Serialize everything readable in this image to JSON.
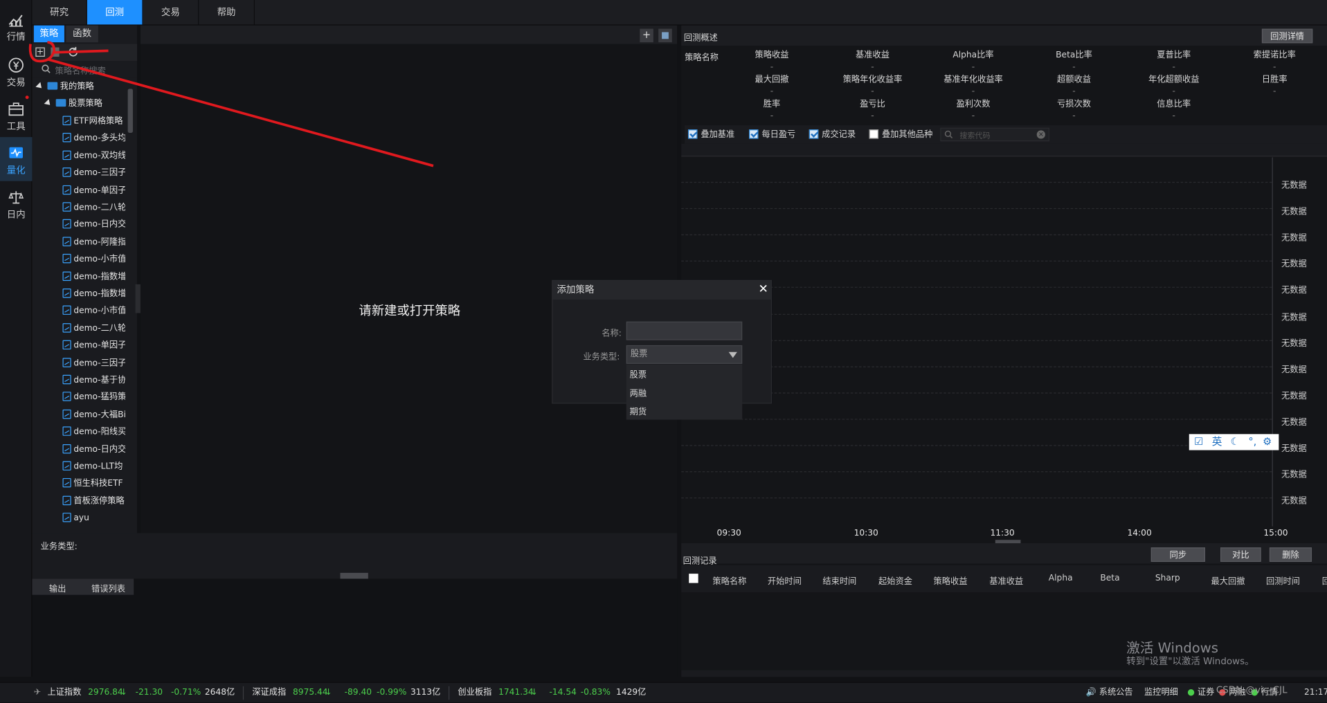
{
  "left_nav": [
    {
      "label": "行情",
      "icon": "chart-trend-icon"
    },
    {
      "label": "交易",
      "icon": "yen-circle-icon"
    },
    {
      "label": "工具",
      "icon": "briefcase-icon"
    },
    {
      "label": "量化",
      "icon": "quant-icon",
      "active": true
    },
    {
      "label": "日内",
      "icon": "scale-icon"
    }
  ],
  "top_tabs": [
    {
      "label": "研究"
    },
    {
      "label": "回测",
      "active": true
    },
    {
      "label": "交易"
    },
    {
      "label": "帮助"
    }
  ],
  "left_panel": {
    "tabs": [
      "策略",
      "函数"
    ],
    "search_placeholder": "策略名称搜索",
    "my_strategies": "我的策略",
    "stock_strategies": "股票策略",
    "items": [
      "ETF网格策略",
      "demo-多头均",
      "demo-双均线",
      "demo-三因子",
      "demo-单因子",
      "demo-二八轮",
      "demo-日内交",
      "demo-阿隆指",
      "demo-小市值",
      "demo-指数增",
      "demo-指数增",
      "demo-小市值",
      "demo-二八轮",
      "demo-单因子",
      "demo-三因子",
      "demo-基于协",
      "demo-猛犸策",
      "demo-大福Bi",
      "demo-阳线买",
      "demo-日内交",
      "demo-LLT均",
      "恒生科技ETF",
      "首板涨停策略",
      "ayu"
    ],
    "business_type_label": "业务类型:"
  },
  "center": {
    "placeholder": "请新建或打开策略",
    "plus_label": "+"
  },
  "output_tabs": [
    "输出",
    "错误列表"
  ],
  "overview": {
    "title": "回测概述",
    "detail_btn": "回测详情",
    "strategy_name_label": "策略名称",
    "row1": [
      "策略收益",
      "基准收益",
      "Alpha比率",
      "Beta比率",
      "夏普比率",
      "索提诺比率"
    ],
    "row2": [
      "最大回撤",
      "策略年化收益率",
      "基准年化收益率",
      "超额收益",
      "年化超额收益",
      "日胜率"
    ],
    "row3": [
      "胜率",
      "盈亏比",
      "盈利次数",
      "亏损次数",
      "信息比率"
    ],
    "empty_value": "-",
    "checkboxes": [
      {
        "label": "叠加基准",
        "checked": true
      },
      {
        "label": "每日盈亏",
        "checked": true
      },
      {
        "label": "成交记录",
        "checked": true
      },
      {
        "label": "叠加其他品种",
        "checked": false
      }
    ],
    "search_placeholder": "搜索代码"
  },
  "chart": {
    "no_data": "无数据",
    "no_data_rows": 13,
    "x_labels": [
      "09:30",
      "10:30",
      "11:30",
      "14:00",
      "15:00"
    ]
  },
  "records": {
    "title": "回测记录",
    "buttons": [
      "同步",
      "对比",
      "删除"
    ],
    "columns": [
      "策略名称",
      "开始时间",
      "结束时间",
      "起始资金",
      "策略收益",
      "基准收益",
      "Alpha",
      "Beta",
      "Sharp",
      "最大回撤",
      "回测时间",
      "回"
    ]
  },
  "dialog": {
    "title": "添加策略",
    "name_label": "名称:",
    "type_label": "业务类型:",
    "type_value": "股票",
    "options": [
      "股票",
      "两融",
      "期货"
    ]
  },
  "ime": {
    "lang": "英"
  },
  "watermark": {
    "line1": "激活 Windows",
    "line2": "转到\"设置\"以激活 Windows。"
  },
  "ticker": [
    {
      "name": "上证指数",
      "price": "2976.84",
      "arrow": "↓",
      "change": "-21.30",
      "pct": "-0.71%",
      "vol": "2648亿"
    },
    {
      "name": "深证成指",
      "price": "8975.44",
      "arrow": "↓",
      "change": "-89.40",
      "pct": "-0.99%",
      "vol": "3113亿"
    },
    {
      "name": "创业板指",
      "price": "1741.34",
      "arrow": "↓",
      "change": "-14.54",
      "pct": "-0.83%",
      "vol": "1429亿"
    }
  ],
  "status_bar": {
    "announcement": "系统公告",
    "monitor": "监控明细",
    "sec": "证券",
    "margin": "两融",
    "quote": "行情",
    "csdn": "CSDN @vic_CJL",
    "time": "21:17"
  },
  "colors": {
    "accent": "#1e90ff",
    "up_green": "#4ccf4c",
    "annotation_red": "#e0191e"
  }
}
